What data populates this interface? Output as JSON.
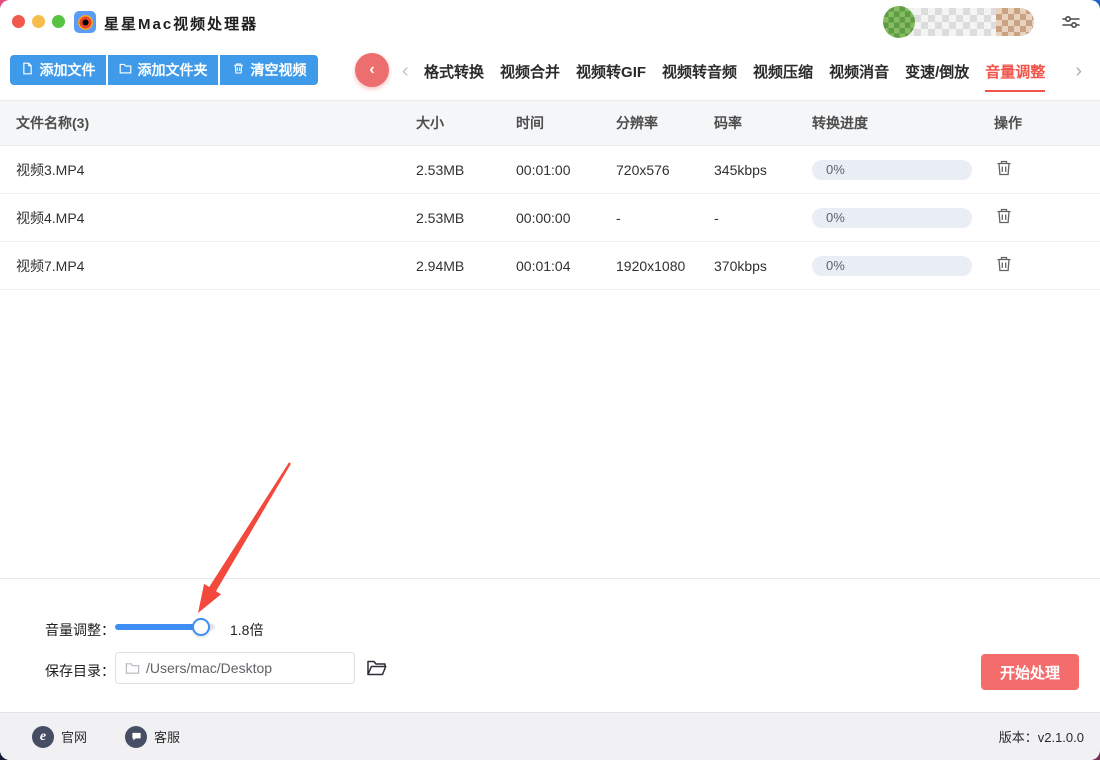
{
  "titlebar": {
    "title": "星星Mac视频处理器"
  },
  "toolbar": {
    "add_file": "添加文件",
    "add_folder": "添加文件夹",
    "clear_videos": "清空视频"
  },
  "nav": {
    "back": "‹",
    "prev": "‹",
    "next": "›",
    "tabs": [
      {
        "label": "格式转换",
        "active": false
      },
      {
        "label": "视频合并",
        "active": false
      },
      {
        "label": "视频转GIF",
        "active": false
      },
      {
        "label": "视频转音频",
        "active": false
      },
      {
        "label": "视频压缩",
        "active": false
      },
      {
        "label": "视频消音",
        "active": false
      },
      {
        "label": "变速/倒放",
        "active": false
      },
      {
        "label": "音量调整",
        "active": true
      }
    ]
  },
  "table": {
    "headers": {
      "name": "文件名称(3)",
      "size": "大小",
      "time": "时间",
      "resolution": "分辨率",
      "bitrate": "码率",
      "progress": "转换进度",
      "action": "操作"
    },
    "rows": [
      {
        "name": "视频3.MP4",
        "size": "2.53MB",
        "time": "00:01:00",
        "resolution": "720x576",
        "bitrate": "345kbps",
        "progress": "0%"
      },
      {
        "name": "视频4.MP4",
        "size": "2.53MB",
        "time": "00:00:00",
        "resolution": "-",
        "bitrate": "-",
        "progress": "0%"
      },
      {
        "name": "视频7.MP4",
        "size": "2.94MB",
        "time": "00:01:04",
        "resolution": "1920x1080",
        "bitrate": "370kbps",
        "progress": "0%"
      }
    ]
  },
  "panel": {
    "volume_label": "音量调整：",
    "volume_value": "1.8倍",
    "save_label": "保存目录：",
    "save_path": "/Users/mac/Desktop",
    "start_button": "开始处理"
  },
  "footer": {
    "site": "官网",
    "support": "客服",
    "version_label": "版本：",
    "version_value": "v2.1.0.0"
  },
  "icons": {
    "toolbar": [
      "file-icon",
      "folder-icon",
      "trash-icon"
    ],
    "titlebar": [
      "app-icon",
      "user-avatar",
      "settings-sliders-icon"
    ],
    "row_action": "trash-icon",
    "footer": [
      "browser-e-icon",
      "chat-bubble-icon"
    ],
    "annotation": "red-arrow"
  },
  "colors": {
    "toolbar_blue": "#3f9bea",
    "back_circle_red": "#ec6e6e",
    "active_tab_red": "#f0544a",
    "start_button_red": "#f56c6c",
    "slider_blue": "#3f8ef5",
    "progress_pill_bg": "#e9edf4"
  }
}
